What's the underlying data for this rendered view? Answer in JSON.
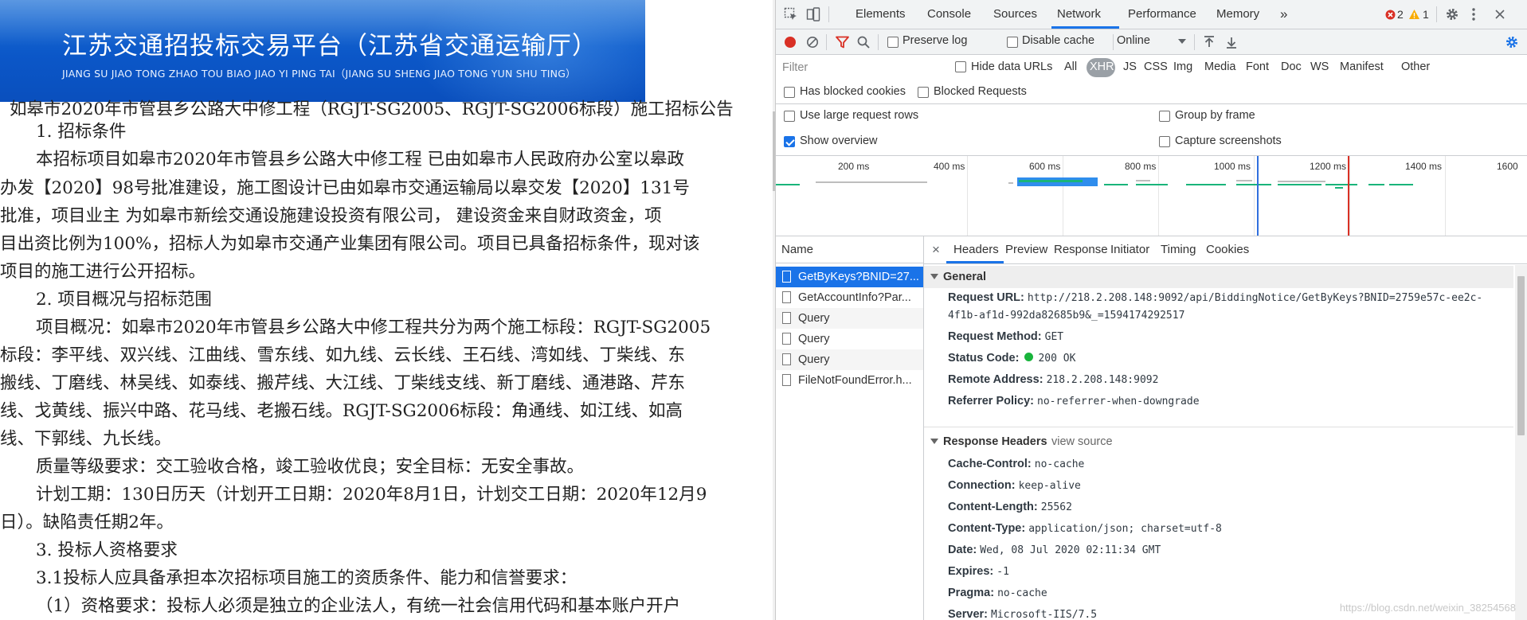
{
  "banner": {
    "title": "江苏交通招投标交易平台（江苏省交通运输厅）",
    "subtitle": "JIANG SU JIAO TONG ZHAO TOU BIAO JIAO YI PING TAI（JIANG SU SHENG JIAO TONG YUN SHU TING）"
  },
  "article": {
    "lines": [
      "如皋市2020年市管县乡公路大中修工程（RGJT-SG2005、RGJT-SG2006标段）施工招标公告",
      "1. 招标条件",
      "本招标项目如皋市2020年市管县乡公路大中修工程 已由如皋市人民政府办公室以皋政",
      "办发【2020】98号批准建设，施工图设计已由如皋市交通运输局以皋交发【2020】131号",
      "批准，项目业主 为如皋市新绘交通设施建设投资有限公司， 建设资金来自财政资金，项",
      "目出资比例为100%，招标人为如皋市交通产业集团有限公司。项目已具备招标条件，现对该",
      "项目的施工进行公开招标。",
      "2. 项目概况与招标范围",
      "项目概况：如皋市2020年市管县乡公路大中修工程共分为两个施工标段：RGJT-SG2005",
      "标段：李平线、双兴线、江曲线、雪东线、如九线、云长线、王石线、湾如线、丁柴线、东",
      "搬线、丁磨线、林吴线、如泰线、搬芹线、大江线、丁柴线支线、新丁磨线、通港路、芹东",
      "线、戈黄线、振兴中路、花马线、老搬石线。RGJT-SG2006标段：角通线、如江线、如高",
      "线、下郭线、九长线。",
      "质量等级要求：交工验收合格，竣工验收优良；安全目标：无安全事故。",
      "计划工期：130日历天（计划开工日期：2020年8月1日，计划交工日期：2020年12月9",
      "日）。缺陷责任期2年。",
      "3. 投标人资格要求",
      "3.1投标人应具备承担本次招标项目施工的资质条件、能力和信誉要求：",
      "（1）资格要求：投标人必须是独立的企业法人，有统一社会信用代码和基本账户开户"
    ]
  },
  "devtools": {
    "tabs": [
      "Elements",
      "Console",
      "Sources",
      "Network",
      "Performance",
      "Memory"
    ],
    "more_tabs": "»",
    "errors": "2",
    "warnings": "1",
    "toolbar": {
      "preserve_log": "Preserve log",
      "disable_cache": "Disable cache",
      "throttle": "Online"
    },
    "filter": {
      "placeholder": "Filter",
      "hide_data_urls": "Hide data URLs",
      "types": [
        "All",
        "XHR",
        "JS",
        "CSS",
        "Img",
        "Media",
        "Font",
        "Doc",
        "WS",
        "Manifest",
        "Other"
      ],
      "active_type": "XHR"
    },
    "options": {
      "has_blocked_cookies": "Has blocked cookies",
      "blocked_requests": "Blocked Requests",
      "large_rows": "Use large request rows",
      "group_by_frame": "Group by frame",
      "show_overview": "Show overview",
      "capture_screenshots": "Capture screenshots"
    },
    "overview_ticks": [
      "200 ms",
      "400 ms",
      "600 ms",
      "800 ms",
      "1000 ms",
      "1200 ms",
      "1400 ms",
      "1600"
    ],
    "name_header": "Name",
    "requests": [
      "GetByKeys?BNID=27...",
      "GetAccountInfo?Par...",
      "Query",
      "Query",
      "Query",
      "FileNotFoundError.h..."
    ],
    "detail_tabs": [
      "Headers",
      "Preview",
      "Response",
      "Initiator",
      "Timing",
      "Cookies"
    ],
    "close": "×",
    "general": {
      "title": "General",
      "request_url_key": "Request URL:",
      "request_url_1": "http://218.2.208.148:9092/api/BiddingNotice/GetByKeys?BNID=2759e57c-ee2c-",
      "request_url_2": "4f1b-af1d-992da82685b9&_=1594174292517",
      "request_method_key": "Request Method:",
      "request_method": "GET",
      "status_code_key": "Status Code:",
      "status_code": "200 OK",
      "remote_address_key": "Remote Address:",
      "remote_address": "218.2.208.148:9092",
      "referrer_policy_key": "Referrer Policy:",
      "referrer_policy": "no-referrer-when-downgrade"
    },
    "response_headers": {
      "title": "Response Headers",
      "view_source": "view source",
      "items": [
        {
          "k": "Cache-Control:",
          "v": "no-cache"
        },
        {
          "k": "Connection:",
          "v": "keep-alive"
        },
        {
          "k": "Content-Length:",
          "v": "25562"
        },
        {
          "k": "Content-Type:",
          "v": "application/json; charset=utf-8"
        },
        {
          "k": "Date:",
          "v": "Wed, 08 Jul 2020 02:11:34 GMT"
        },
        {
          "k": "Expires:",
          "v": "-1"
        },
        {
          "k": "Pragma:",
          "v": "no-cache"
        },
        {
          "k": "Server:",
          "v": "Microsoft-IIS/7.5"
        }
      ]
    },
    "watermark": "https://blog.csdn.net/weixin_38254568"
  }
}
